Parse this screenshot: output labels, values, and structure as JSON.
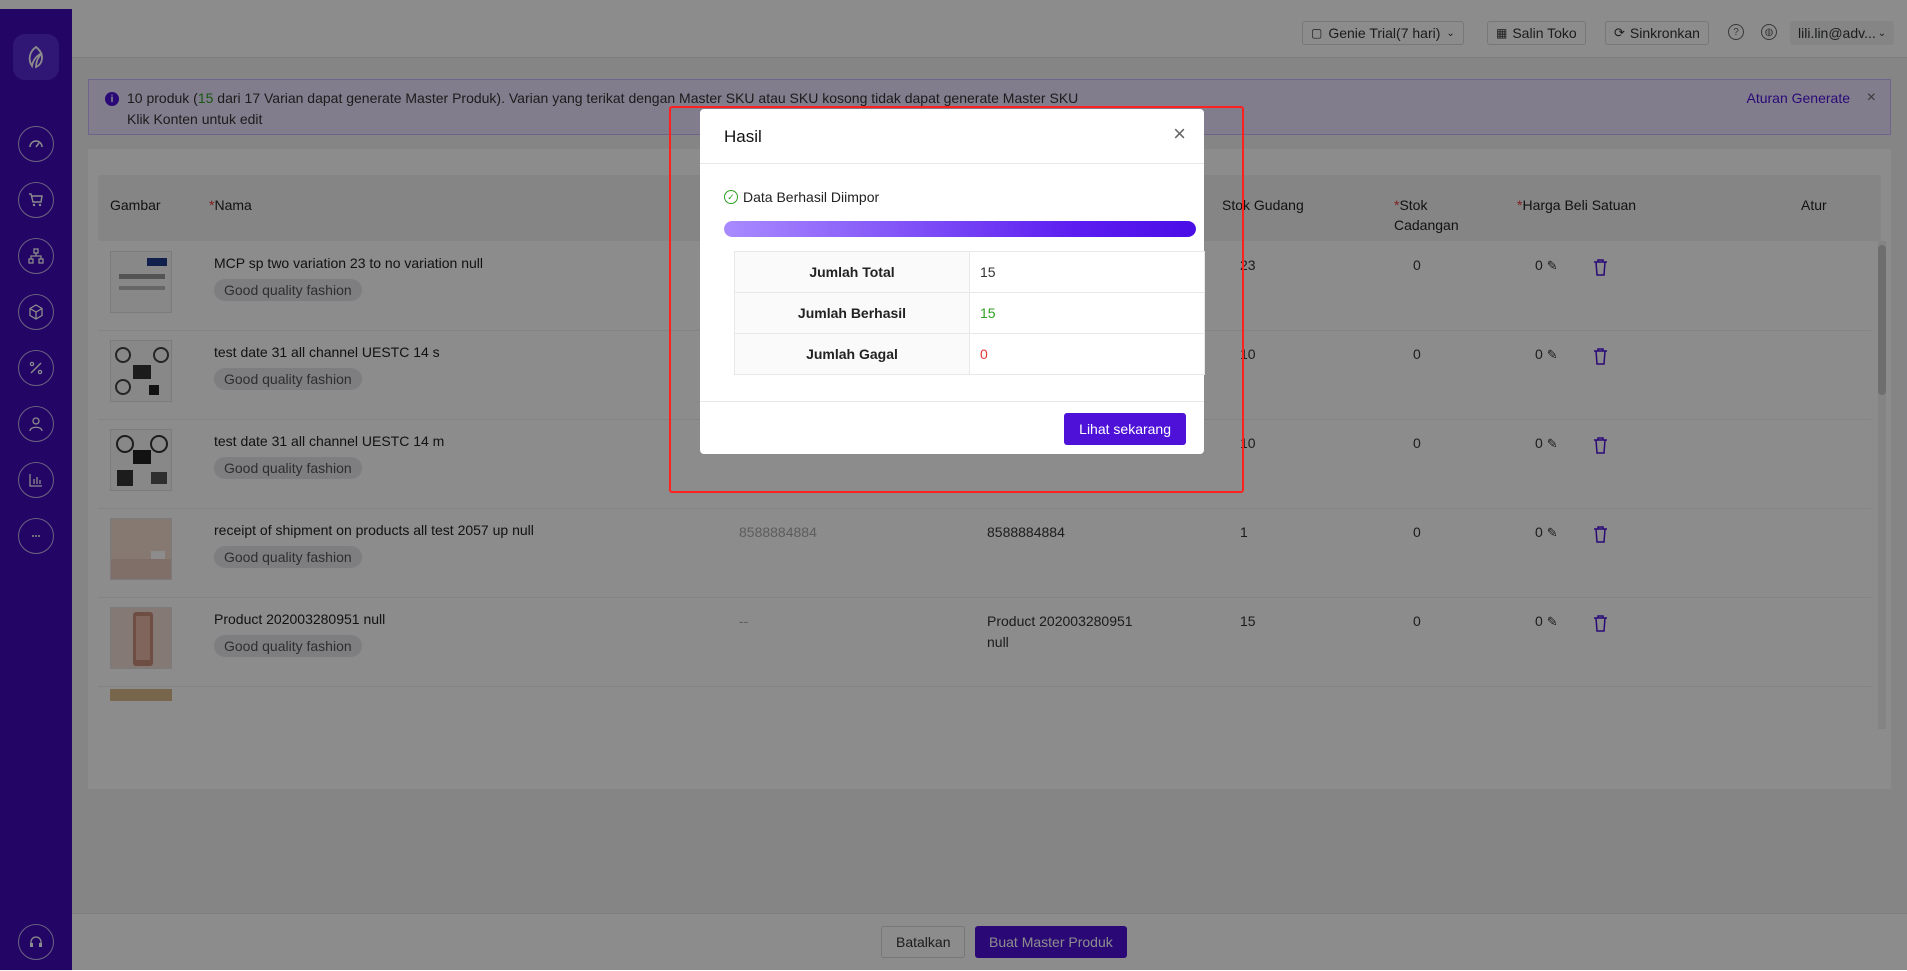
{
  "header": {
    "trial_label": "Genie Trial(7 hari)",
    "copy_store": "Salin Toko",
    "sync": "Sinkronkan",
    "user": "lili.lin@adv..."
  },
  "banner": {
    "line1_prefix": "10 produk (",
    "line1_count": "15",
    "line1_suffix": " dari 17 Varian dapat generate Master Produk). Varian yang terikat dengan Master SKU atau SKU kosong tidak dapat generate Master SKU",
    "line2": "Klik Konten untuk edit",
    "rule_link": "Aturan Generate"
  },
  "table": {
    "columns": {
      "image": "Gambar",
      "name": "Nama",
      "warehouse_stock": "Stok Gudang",
      "reserve_stock_1": "Stok",
      "reserve_stock_2": "Cadangan",
      "unit_price": "Harga Beli Satuan",
      "action": "Atur"
    },
    "rows": [
      {
        "name": "MCP sp two variation 23 to no variation null",
        "tag": "Good quality fashion",
        "sku": "",
        "master_sku": "",
        "stock": "23",
        "reserve": "0",
        "price": "0"
      },
      {
        "name": "test date 31 all channel UESTC 14 s",
        "tag": "Good quality fashion",
        "sku": "",
        "master_sku": "",
        "stock": "10",
        "reserve": "0",
        "price": "0"
      },
      {
        "name": "test date 31 all channel UESTC 14 m",
        "tag": "Good quality fashion",
        "sku": "",
        "master_sku": "",
        "stock": "10",
        "reserve": "0",
        "price": "0"
      },
      {
        "name": "receipt of shipment on products all test 2057 up null",
        "tag": "Good quality fashion",
        "sku": "8588884884",
        "master_sku": "8588884884",
        "stock": "1",
        "reserve": "0",
        "price": "0"
      },
      {
        "name": "Product 202003280951 null",
        "tag": "Good quality fashion",
        "sku": "--",
        "master_sku": "Product 202003280951",
        "master_sku_2": "null",
        "stock": "15",
        "reserve": "0",
        "price": "0"
      }
    ]
  },
  "footer": {
    "cancel": "Batalkan",
    "create": "Buat Master Produk"
  },
  "modal": {
    "title": "Hasil",
    "status": "Data Berhasil Diimpor",
    "progress": 1.0,
    "results": [
      {
        "label": "Jumlah Total",
        "value": "15"
      },
      {
        "label": "Jumlah Berhasil",
        "value": "15"
      },
      {
        "label": "Jumlah Gagal",
        "value": "0"
      }
    ],
    "view_button": "Lihat sekarang"
  },
  "colors": {
    "primary": "#4d11d8",
    "sidebar": "#3f0ab8",
    "success": "#2ea121",
    "danger": "#e53935"
  }
}
